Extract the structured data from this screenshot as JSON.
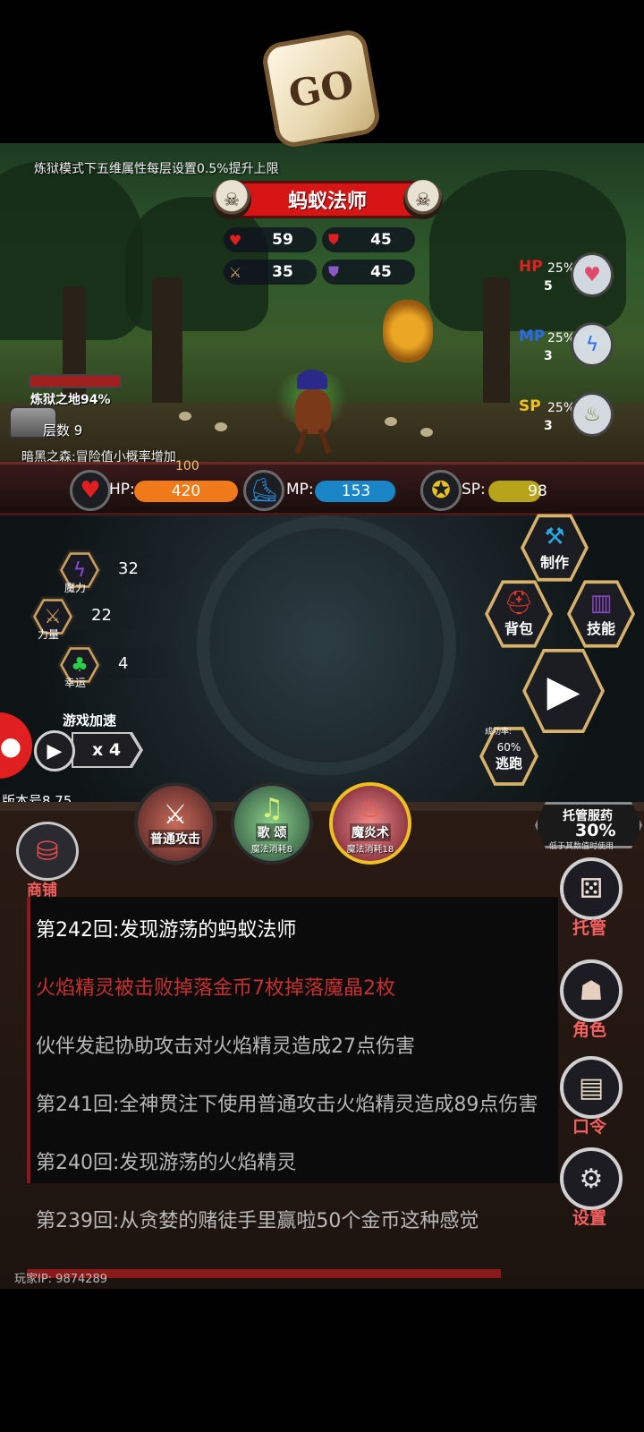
{
  "scene": {
    "hint_top": "炼狱模式下五维属性每层设置0.5%提升上限",
    "enemy_name": "蚂蚁法师",
    "enemy_stats": [
      {
        "icon": "heart-icon",
        "value": "59",
        "color": "#e02020"
      },
      {
        "icon": "shield-red-icon",
        "value": "45",
        "color": "#e02020"
      },
      {
        "icon": "sword-icon",
        "value": "35",
        "color": "#c8a060"
      },
      {
        "icon": "shield-purple-icon",
        "value": "45",
        "color": "#8a5ac8"
      }
    ],
    "potions": [
      {
        "tag": "HP",
        "percent": "25%",
        "count": "5",
        "color": "#e02020"
      },
      {
        "tag": "MP",
        "percent": "25%",
        "count": "3",
        "color": "#2a6af0"
      },
      {
        "tag": "SP",
        "percent": "25%",
        "count": "3",
        "color": "#f0c020"
      }
    ],
    "floor_title": "炼狱之地94%",
    "floor_num": "层数 9",
    "hint_bottom": "暗黑之森:冒险值小概率增加"
  },
  "player": {
    "hp_max": "100",
    "hp_label": "HP:",
    "hp_value": "420",
    "hp_fill": 1.0,
    "mp_label": "MP:",
    "mp_value": "153",
    "mp_fill": 0.98,
    "sp_label": "SP:",
    "sp_value": "98",
    "sp_fill": 0.98,
    "colors": {
      "hp": "#f07a1a",
      "mp": "#1a86c8",
      "sp": "#b8a41a"
    }
  },
  "attributes": [
    {
      "name": "魔力",
      "value": "32",
      "icon": "magic-icon"
    },
    {
      "name": "力量",
      "value": "22",
      "icon": "sword-icon"
    },
    {
      "name": "幸运",
      "value": "4",
      "icon": "clover-icon"
    }
  ],
  "dice_text": "GO",
  "buttons": {
    "craft": "制作",
    "bag": "背包",
    "skills": "技能",
    "escape": "逃跑",
    "escape_rate_caption": "成功率:",
    "escape_rate": "60%"
  },
  "speed": {
    "label": "游戏加速",
    "multiplier": "x 4"
  },
  "version": "版本号8.75",
  "skills_row": [
    {
      "name": "普通攻击",
      "cost": ""
    },
    {
      "name": "歌 颂",
      "cost": "魔法消耗8"
    },
    {
      "name": "魔炎术",
      "cost": "魔法消耗18"
    }
  ],
  "auto_potion": {
    "title": "托管服药",
    "percent": "30%",
    "note": "低于其数值时使用"
  },
  "shop_label": "商铺",
  "log": [
    {
      "text": "第242回:发现游荡的蚂蚁法师",
      "color": "#ffffff"
    },
    {
      "text": "火焰精灵被击败掉落金币7枚掉落魔晶2枚",
      "color": "#c83030"
    },
    {
      "text": "伙伴发起协助攻击对火焰精灵造成27点伤害",
      "color": "#b8b8b8"
    },
    {
      "text": "第241回:全神贯注下使用普通攻击火焰精灵造成89点伤害",
      "color": "#b8b8b8"
    },
    {
      "text": "第240回:发现游荡的火焰精灵",
      "color": "#b8b8b8"
    },
    {
      "text": "第239回:从贪婪的赌徒手里赢啦50个金币这种感觉",
      "color": "#b8b8b8"
    }
  ],
  "side_menu": [
    "托管",
    "角色",
    "口令",
    "设置"
  ],
  "player_ip": "玩家IP: 9874289"
}
